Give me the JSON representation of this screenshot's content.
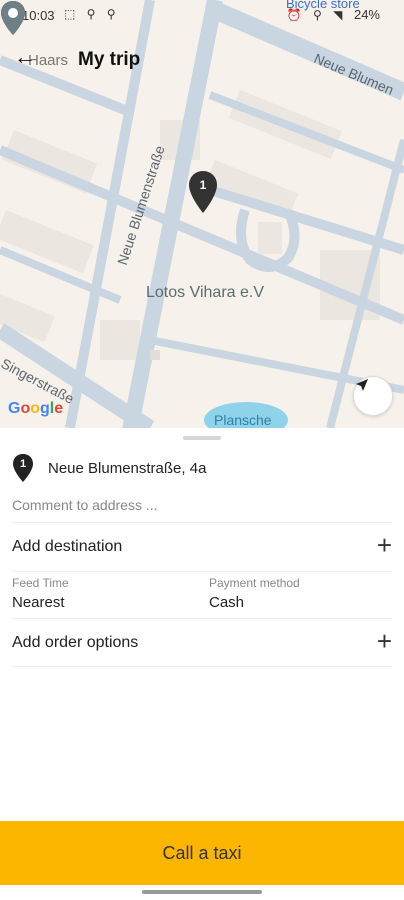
{
  "status_bar": {
    "time": "10:03",
    "battery": "24%"
  },
  "header": {
    "title": "My trip"
  },
  "map": {
    "labels": {
      "neue_blumen_top": "Neue Blumen",
      "neue_blumen_vert": "Neue Blumenstraße",
      "singer": "Singerstraße",
      "lotos": "Lotos Vihara e.V",
      "plansche": "Plansche",
      "bicycle": "Bicycle store",
      "haars": "Haars"
    },
    "pin_number": "1",
    "google": [
      "G",
      "o",
      "o",
      "g",
      "l",
      "e"
    ]
  },
  "trip": {
    "pickup_number": "1",
    "pickup_address": "Neue Blumenstraße, 4a",
    "comment_placeholder": "Comment to address ...",
    "add_destination": "Add destination",
    "feed_time_caption": "Feed Time",
    "feed_time_value": "Nearest",
    "payment_caption": "Payment method",
    "payment_value": "Cash",
    "add_order_options": "Add order options",
    "call_taxi": "Call a taxi"
  },
  "colors": {
    "accent": "#fcb600",
    "map_bg": "#f6f1ea",
    "road": "#c9d5e0",
    "pin": "#333333",
    "pin_gray": "#6f7f86"
  },
  "icons": {
    "back": "arrow-left-icon",
    "plus": "plus-icon",
    "locate": "navigation-arrow-icon",
    "pin": "map-pin-icon"
  }
}
